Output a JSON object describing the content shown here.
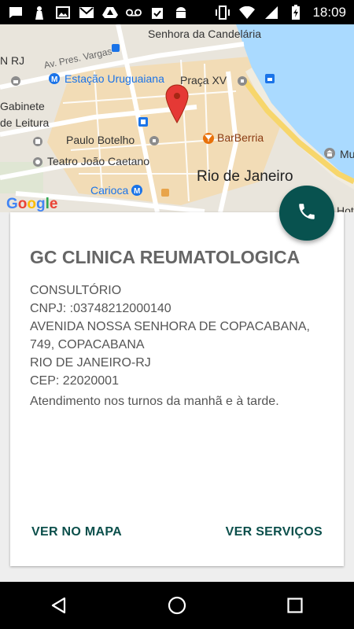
{
  "status_bar": {
    "time": "18:09",
    "left_icons": [
      "message-icon",
      "notification-person-icon",
      "image-icon",
      "gmail-icon",
      "drive-icon",
      "voicemail-icon",
      "clipboard-check-icon",
      "android-icon"
    ],
    "right_icons": [
      "vibrate-icon",
      "wifi-icon",
      "signal-icon",
      "battery-charging-icon"
    ]
  },
  "map": {
    "labels": {
      "candelaria_top": "Senhora da Candelária",
      "pres_vargas": "Av. Pres. Vargas",
      "n_rj": "N RJ",
      "estacao": "Estação Uruguaiana",
      "praca_xv": "Praça XV",
      "gabinete": "Gabinete",
      "de_leitura": "de Leitura",
      "paulo_botelho": "Paulo Botelho",
      "barberria": "BarBerria",
      "teatro": "Teatro João Caetano",
      "rio": "Rio de Janeiro",
      "carioca": "Carioca",
      "mu": "Mu",
      "hot": "Hot"
    },
    "attribution": "Google"
  },
  "card": {
    "title": "GC CLINICA REUMATOLOGICA",
    "lines": [
      "CONSULTÓRIO",
      "CNPJ: :03748212000140",
      "AVENIDA NOSSA SENHORA DE COPACABANA, 749, COPACABANA",
      "RIO DE JANEIRO-RJ",
      "CEP: 22020001"
    ],
    "note": "Atendimento nos turnos da manhã e à tarde.",
    "map_button": "VER NO MAPA",
    "services_button": "VER SERVIÇOS"
  },
  "colors": {
    "accent": "#08524f",
    "button_text": "#0b4f4b",
    "pin": "#e53935"
  }
}
